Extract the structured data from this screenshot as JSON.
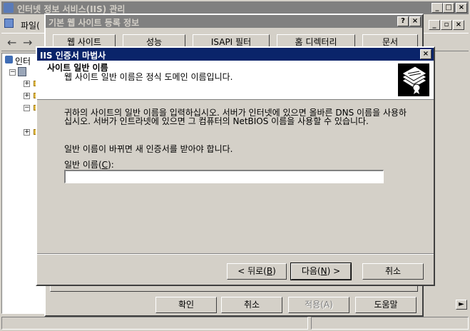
{
  "main_window": {
    "title": "인터넷 정보 서비스(IIS) 관리",
    "menu_file": "파일(",
    "tree_label": "인터",
    "min_label": "_",
    "max_label": "□",
    "close_label": "×"
  },
  "props_dialog": {
    "title": "기본 웹 사이트 등록 정보",
    "help_label": "?",
    "close_label": "×",
    "tabs": [
      "웹 사이트",
      "성능",
      "ISAPI 필터",
      "홈 디렉터리",
      "문서"
    ],
    "buttons": {
      "ok": "확인",
      "cancel": "취소",
      "apply": "적용(A)",
      "help": "도움말"
    }
  },
  "wizard": {
    "title": "IIS 인증서 마법사",
    "close_label": "×",
    "header_title": "사이트 일반 이름",
    "header_subtitle": "웹 사이트 일반 이름은 정식 도메인 이름입니다.",
    "paragraph1": "귀하의 사이트의 일반 이름을 입력하십시오. 서버가 인터넷에 있으면 올바른 DNS 이름을 사용하십시오. 서버가 인트라넷에 있으면 그 컴퓨터의 NetBIOS 이름을 사용할 수 있습니다.",
    "paragraph2": "일반 이름이 바뀌면 새 인증서를 받아야 합니다.",
    "field_label": "일반 이름(C):",
    "field_value": "",
    "buttons": {
      "back": "< 뒤로(B)",
      "next": "다음(N) >",
      "cancel": "취소"
    }
  },
  "colors": {
    "title_active": "#0a246a",
    "title_inactive": "#808080",
    "face": "#d4d0c8"
  }
}
